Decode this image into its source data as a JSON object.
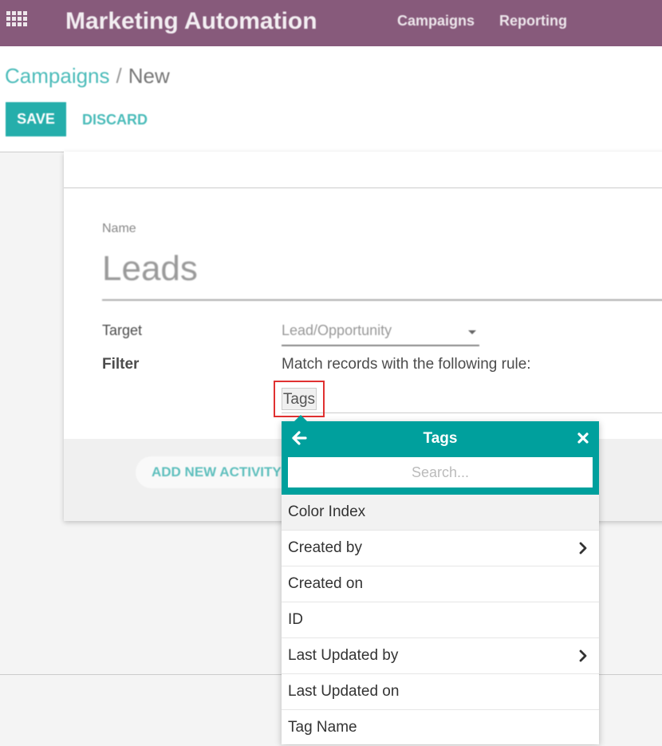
{
  "topbar": {
    "app_title": "Marketing Automation",
    "menu": [
      "Campaigns",
      "Reporting"
    ]
  },
  "breadcrumb": {
    "parent": "Campaigns",
    "separator": "/",
    "current": "New"
  },
  "actions": {
    "save": "SAVE",
    "discard": "DISCARD"
  },
  "form": {
    "name_label": "Name",
    "name_value": "Leads",
    "target_label": "Target",
    "target_value": "Lead/Opportunity",
    "filter_label": "Filter",
    "filter_text": "Match records with the following rule:",
    "filter_tag": "Tags",
    "add_activity": "ADD NEW ACTIVITY"
  },
  "popover": {
    "title": "Tags",
    "search_placeholder": "Search...",
    "items": [
      {
        "label": "Color Index",
        "has_children": false
      },
      {
        "label": "Created by",
        "has_children": true
      },
      {
        "label": "Created on",
        "has_children": false
      },
      {
        "label": "ID",
        "has_children": false
      },
      {
        "label": "Last Updated by",
        "has_children": true
      },
      {
        "label": "Last Updated on",
        "has_children": false
      },
      {
        "label": "Tag Name",
        "has_children": false
      }
    ]
  },
  "colors": {
    "brand": "#875a7b",
    "accent": "#00a09d",
    "highlight_border": "#e03131"
  }
}
